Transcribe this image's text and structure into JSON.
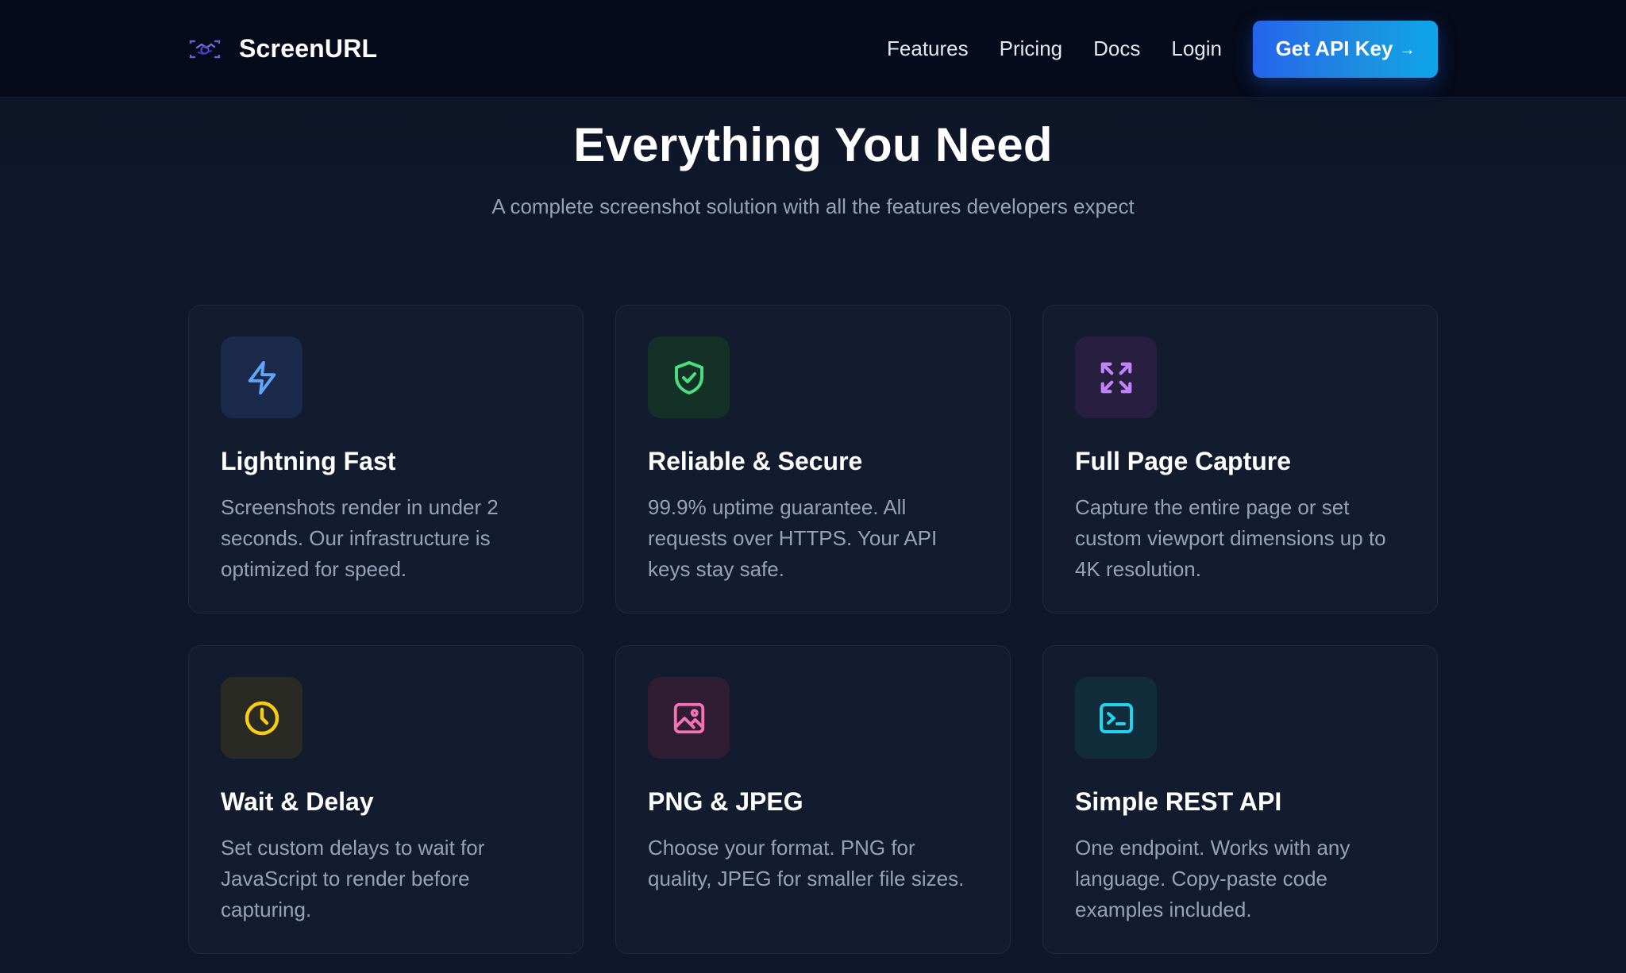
{
  "header": {
    "brand_name": "ScreenURL",
    "nav": [
      {
        "label": "Features"
      },
      {
        "label": "Pricing"
      },
      {
        "label": "Docs"
      },
      {
        "label": "Login"
      }
    ],
    "cta_label": "Get API Key",
    "cta_arrow": "→"
  },
  "hero": {
    "title": "Everything You Need",
    "subtitle": "A complete screenshot solution with all the features developers expect"
  },
  "features": [
    {
      "icon": "lightning-icon",
      "title": "Lightning Fast",
      "description": "Screenshots render in under 2 seconds. Our infrastructure is optimized for speed.",
      "accent": "#60a5fa",
      "icon_bg": "#1b2a4a"
    },
    {
      "icon": "shield-check-icon",
      "title": "Reliable & Secure",
      "description": "99.9% uptime guarantee. All requests over HTTPS. Your API keys stay safe.",
      "accent": "#4ade80",
      "icon_bg": "#143128"
    },
    {
      "icon": "expand-icon",
      "title": "Full Page Capture",
      "description": "Capture the entire page or set custom viewport dimensions up to 4K resolution.",
      "accent": "#c084fc",
      "icon_bg": "#281f40"
    },
    {
      "icon": "clock-icon",
      "title": "Wait & Delay",
      "description": "Set custom delays to wait for JavaScript to render before capturing.",
      "accent": "#facc15",
      "icon_bg": "#2a2a25"
    },
    {
      "icon": "image-icon",
      "title": "PNG & JPEG",
      "description": "Choose your format. PNG for quality, JPEG for smaller file sizes.",
      "accent": "#f472b6",
      "icon_bg": "#2f1d34"
    },
    {
      "icon": "terminal-icon",
      "title": "Simple REST API",
      "description": "One endpoint. Works with any language. Copy-paste code examples included.",
      "accent": "#22d3ee",
      "icon_bg": "#112c3a"
    }
  ]
}
